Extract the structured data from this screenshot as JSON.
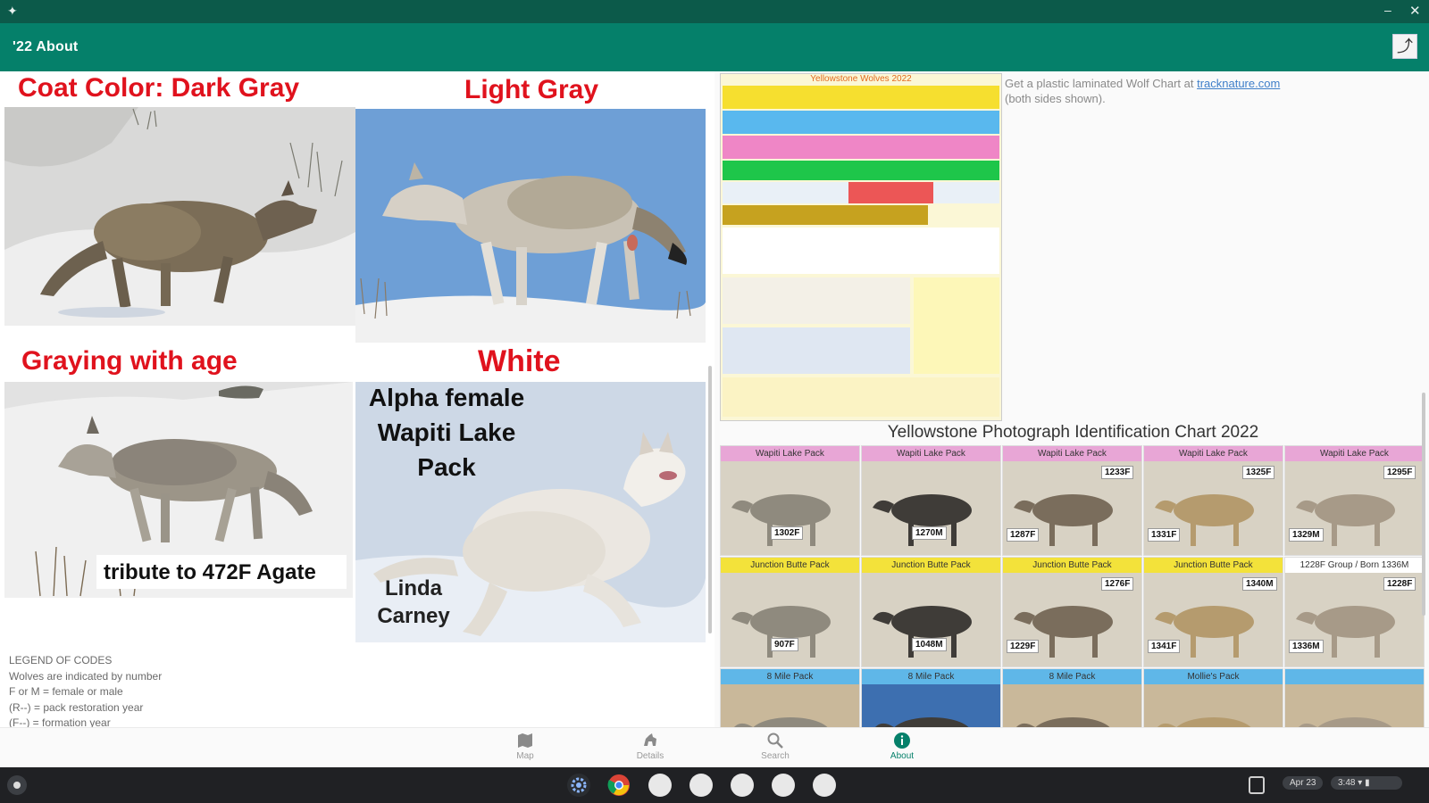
{
  "app": {
    "title": "'22 About",
    "open_external_icon": "open-in-new-icon"
  },
  "left": {
    "headings": {
      "dark_gray": "Coat Color:  Dark Gray",
      "light_gray": "Light Gray",
      "graying": "Graying with age",
      "white": "White"
    },
    "captions": {
      "tribute": "tribute to 472F Agate",
      "alpha_female": "Alpha female\nWapiti Lake\nPack",
      "photographer": "Linda\nCarney"
    },
    "legend": {
      "title": "LEGEND OF CODES",
      "lines": [
        "Wolves are indicated by number",
        "F or M = female or male",
        "(R--) = pack restoration year",
        "(F--) = formation year"
      ]
    }
  },
  "right": {
    "chart_thumb_title": "Yellowstone Wolves 2022",
    "note_prefix": "Get a plastic laminated Wolf Chart at ",
    "note_link": "tracknature.com",
    "note_suffix": "(both sides shown).",
    "id_chart_title": "Yellowstone Photograph Identification Chart 2022",
    "id_rows": [
      {
        "color": "#e8a6d6",
        "cells": [
          {
            "pack": "Wapiti Lake Pack",
            "tags": [
              "1302F"
            ]
          },
          {
            "pack": "Wapiti Lake Pack",
            "tags": [
              "1270M"
            ]
          },
          {
            "pack": "Wapiti Lake Pack",
            "tags": [
              "1233F",
              "1287F"
            ]
          },
          {
            "pack": "Wapiti Lake Pack",
            "tags": [
              "1325F",
              "1331F"
            ]
          },
          {
            "pack": "Wapiti Lake Pack",
            "tags": [
              "1295F",
              "1329M"
            ]
          }
        ]
      },
      {
        "color": "#f3e23a",
        "cells": [
          {
            "pack": "Junction Butte Pack",
            "tags": [
              "907F"
            ]
          },
          {
            "pack": "Junction Butte Pack",
            "tags": [
              "1048M"
            ]
          },
          {
            "pack": "Junction Butte Pack",
            "tags": [
              "1276F",
              "1229F"
            ]
          },
          {
            "pack": "Junction Butte Pack",
            "tags": [
              "1340M",
              "1341F"
            ]
          },
          {
            "pack": "1228F Group / Born 1336M",
            "tags": [
              "1228F",
              "1336M"
            ]
          }
        ]
      },
      {
        "color": "#5fb7e8",
        "cells": [
          {
            "pack": "8 Mile Pack",
            "tags": []
          },
          {
            "pack": "8 Mile Pack",
            "tags": []
          },
          {
            "pack": "8 Mile Pack",
            "tags": []
          },
          {
            "pack": "Mollie's Pack",
            "tags": []
          },
          {
            "pack": "",
            "tags": []
          }
        ]
      }
    ]
  },
  "bottom_nav": [
    {
      "label": "Map",
      "icon": "map-icon",
      "active": false
    },
    {
      "label": "Details",
      "icon": "wolf-icon",
      "active": false
    },
    {
      "label": "Search",
      "icon": "search-icon",
      "active": false
    },
    {
      "label": "About",
      "icon": "info-icon",
      "active": true
    }
  ],
  "taskbar": {
    "date": "Apr 23",
    "time": "3:48",
    "icons": [
      "launcher-icon",
      "settings-icon",
      "chrome-icon",
      "files-icon",
      "app-icon",
      "app-icon",
      "app-icon",
      "app-icon"
    ]
  },
  "colors": {
    "appbar": "#05806a",
    "heading_red": "#e0121d",
    "active_nav": "#05806a"
  }
}
